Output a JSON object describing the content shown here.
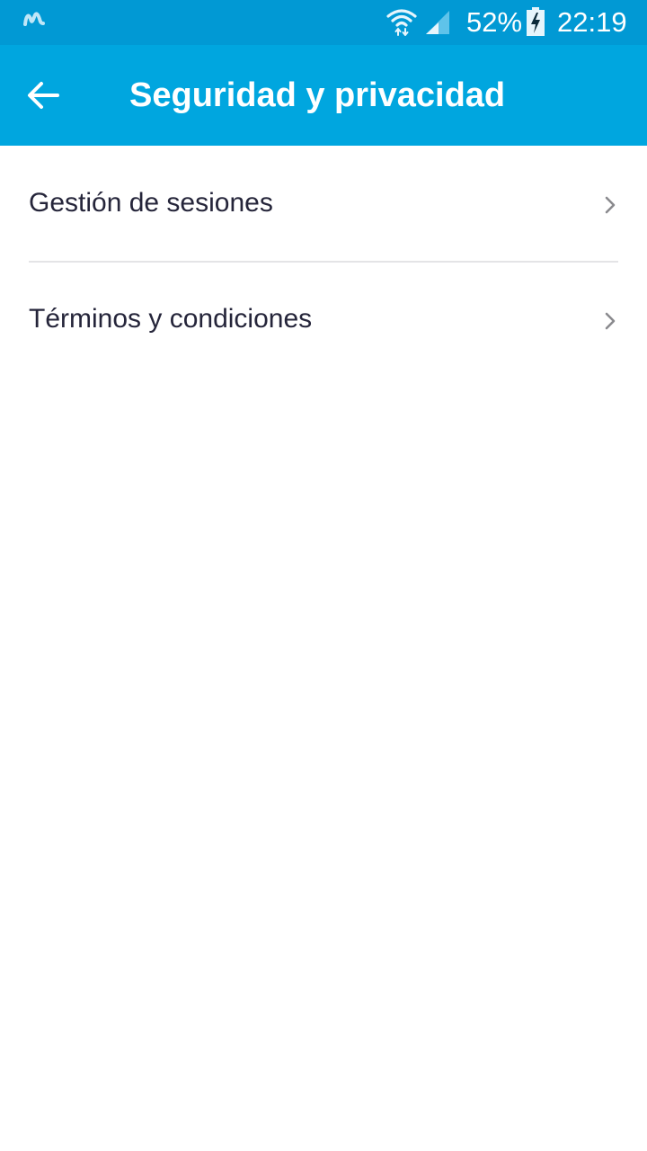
{
  "status_bar": {
    "carrier_icon": "movistar-logo-icon",
    "wifi_icon": "wifi-icon",
    "signal_icon": "cell-signal-icon",
    "battery_percent": "52%",
    "battery_icon": "battery-charging-icon",
    "time": "22:19",
    "background_color": "#0199d4"
  },
  "app_bar": {
    "back_icon": "arrow-back-icon",
    "title": "Seguridad y privacidad",
    "background_color": "#00a6df"
  },
  "menu": {
    "items": [
      {
        "label": "Gestión de sesiones",
        "icon": "chevron-right-icon"
      },
      {
        "label": "Términos y condiciones",
        "icon": "chevron-right-icon"
      }
    ]
  }
}
